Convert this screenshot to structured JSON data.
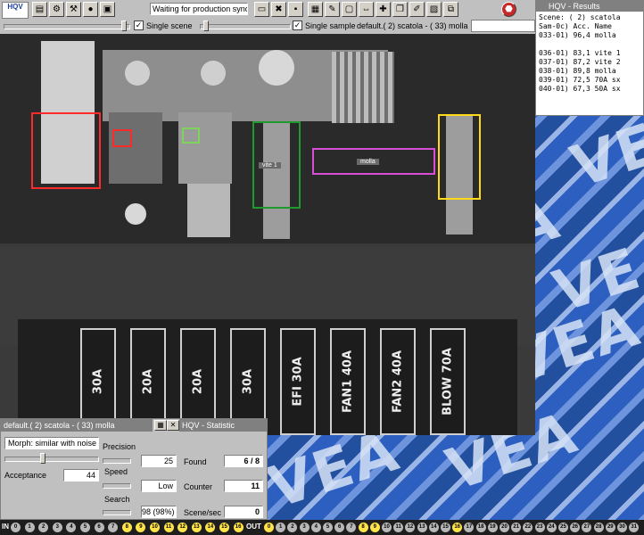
{
  "toolbar": {
    "status": "Waiting for production sync",
    "single_scene_label": "Single scene",
    "single_sample_label": "Single sample",
    "current_selection": "default.( 2) scatola - ( 33) molla",
    "logo_text": "HQV",
    "icons": [
      "open-icon",
      "settings-icon",
      "tools-icon",
      "run-icon",
      "camera-icon",
      "monitor-icon",
      "delete-icon",
      "save-icon",
      "layout-icon",
      "teach-icon",
      "frame-icon",
      "align-icon",
      "crosshair-icon",
      "window-icon",
      "edit-icon",
      "image-icon",
      "copy-icon",
      "stop-icon"
    ]
  },
  "camera": {
    "roi_labels": {
      "vite": "vite 1",
      "molla": "molla"
    },
    "fuse_labels": [
      "30A",
      "20A",
      "20A",
      "30A",
      "EFI 30A",
      "FAN1 40A",
      "FAN2 40A",
      "BLOW 70A"
    ],
    "colors": {
      "red": "#ff2a2a",
      "green": "#1f9a2f",
      "magenta": "#d64fd6",
      "yellow": "#ffd81a",
      "lightgreen": "#7fd35a"
    }
  },
  "results": {
    "title": "HQV - Results",
    "lines": [
      "Scene: ( 2) scatola",
      "Sam-0c) Acc. Name",
      "033-01) 96,4 molla",
      "",
      "036-01) 83,1 vite 1",
      "037-01) 87,2 vite 2",
      "038-01) 89,8 molla",
      "039-01) 72,5 70A sx",
      "040-01) 67,3 50A sx"
    ]
  },
  "statistic": {
    "title": "default.( 2) scatola - ( 33) molla",
    "title2": "HQV - Statistic",
    "morph": "Morph: similar with noise",
    "acceptance_label": "Acceptance",
    "acceptance": "44",
    "precision_label": "Precision",
    "precision": "25",
    "speed_label": "Speed",
    "speed": "Low",
    "search_label": "Search",
    "search": "98 (98%)",
    "found_label": "Found",
    "found": "6 / 8",
    "counter_label": "Counter",
    "counter": "11",
    "scene_sec_label": "Scene/sec",
    "scene_sec": "0"
  },
  "io": {
    "in_label": "IN",
    "out_label": "OUT",
    "in_dots": [
      {
        "n": "0",
        "on": false
      },
      {
        "n": "1",
        "on": false
      },
      {
        "n": "2",
        "on": false
      },
      {
        "n": "3",
        "on": false
      },
      {
        "n": "4",
        "on": false
      },
      {
        "n": "5",
        "on": false
      },
      {
        "n": "6",
        "on": false
      },
      {
        "n": "7",
        "on": false
      },
      {
        "n": "8",
        "on": true
      },
      {
        "n": "9",
        "on": true
      },
      {
        "n": "10",
        "on": true
      },
      {
        "n": "11",
        "on": true
      },
      {
        "n": "12",
        "on": true
      },
      {
        "n": "13",
        "on": true
      },
      {
        "n": "14",
        "on": true
      },
      {
        "n": "15",
        "on": true
      },
      {
        "n": "16",
        "on": true
      }
    ],
    "out_dots": [
      {
        "n": "0",
        "on": true
      },
      {
        "n": "1",
        "on": false
      },
      {
        "n": "2",
        "on": false
      },
      {
        "n": "3",
        "on": false
      },
      {
        "n": "4",
        "on": false
      },
      {
        "n": "5",
        "on": false
      },
      {
        "n": "6",
        "on": false
      },
      {
        "n": "7",
        "on": false
      },
      {
        "n": "8",
        "on": true
      },
      {
        "n": "9",
        "on": true
      },
      {
        "n": "10",
        "on": false
      },
      {
        "n": "11",
        "on": false
      },
      {
        "n": "12",
        "on": false
      },
      {
        "n": "13",
        "on": false
      },
      {
        "n": "14",
        "on": false
      },
      {
        "n": "15",
        "on": false
      },
      {
        "n": "16",
        "on": true
      },
      {
        "n": "17",
        "on": false
      },
      {
        "n": "18",
        "on": false
      },
      {
        "n": "19",
        "on": false
      },
      {
        "n": "20",
        "on": false
      },
      {
        "n": "21",
        "on": false
      },
      {
        "n": "22",
        "on": false
      },
      {
        "n": "23",
        "on": false
      },
      {
        "n": "24",
        "on": false
      },
      {
        "n": "25",
        "on": false
      },
      {
        "n": "26",
        "on": false
      },
      {
        "n": "27",
        "on": false
      },
      {
        "n": "28",
        "on": false
      },
      {
        "n": "29",
        "on": false
      },
      {
        "n": "30",
        "on": false
      },
      {
        "n": "31",
        "on": false
      }
    ]
  }
}
